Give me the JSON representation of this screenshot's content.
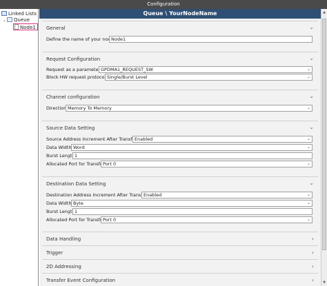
{
  "window": {
    "title": "Configuration"
  },
  "tree": {
    "root": "Linked Lists",
    "queue": "Queue",
    "node": "Node1"
  },
  "header": {
    "title": "Queue \\ YourNodeName"
  },
  "general": {
    "title": "General",
    "name_label": "Define the name of your node",
    "name_value": "Node1"
  },
  "request": {
    "title": "Request Configuration",
    "param_label": "Request as a parameter",
    "param_value": "GPDMA1_REQUEST_SW",
    "hw_label": "Block HW request protocol",
    "hw_value": "Single/Burst Level"
  },
  "channel": {
    "title": "Channel configuration",
    "direction_label": "Direction",
    "direction_value": "Memory To Memory"
  },
  "source": {
    "title": "Source Data Setting",
    "inc_label": "Source Address Increment After Transfer",
    "inc_value": "Enabled",
    "width_label": "Data Width",
    "width_value": "Word",
    "burst_label": "Burst Length",
    "burst_value": "1",
    "port_label": "Allocated Port for Transfer",
    "port_value": "Port 0"
  },
  "destination": {
    "title": "Destination Data Setting",
    "inc_label": "Destination Address Increment After Transfer",
    "inc_value": "Enabled",
    "width_label": "Data Width",
    "width_value": "Byte",
    "burst_label": "Burst Length",
    "burst_value": "1",
    "port_label": "Allocated Port for Transfer",
    "port_value": "Port 0"
  },
  "collapsed": {
    "data_handling": "Data Handling",
    "trigger": "Trigger",
    "addressing_2d": "2D Addressing",
    "transfer_event": "Transfer Event Configuration"
  },
  "icons": {
    "expanded": "chevron-down-icon",
    "collapsed": "chevron-right-icon"
  }
}
